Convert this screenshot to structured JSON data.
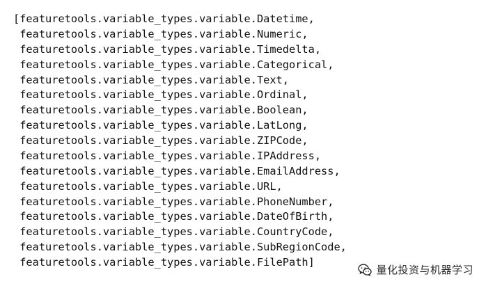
{
  "output": {
    "lines": [
      "[featuretools.variable_types.variable.Datetime,",
      " featuretools.variable_types.variable.Numeric,",
      " featuretools.variable_types.variable.Timedelta,",
      " featuretools.variable_types.variable.Categorical,",
      " featuretools.variable_types.variable.Text,",
      " featuretools.variable_types.variable.Ordinal,",
      " featuretools.variable_types.variable.Boolean,",
      " featuretools.variable_types.variable.LatLong,",
      " featuretools.variable_types.variable.ZIPCode,",
      " featuretools.variable_types.variable.IPAddress,",
      " featuretools.variable_types.variable.EmailAddress,",
      " featuretools.variable_types.variable.URL,",
      " featuretools.variable_types.variable.PhoneNumber,",
      " featuretools.variable_types.variable.DateOfBirth,",
      " featuretools.variable_types.variable.CountryCode,",
      " featuretools.variable_types.variable.SubRegionCode,",
      " featuretools.variable_types.variable.FilePath]"
    ]
  },
  "watermark": {
    "text": "量化投资与机器学习",
    "icon": "wechat-icon"
  }
}
